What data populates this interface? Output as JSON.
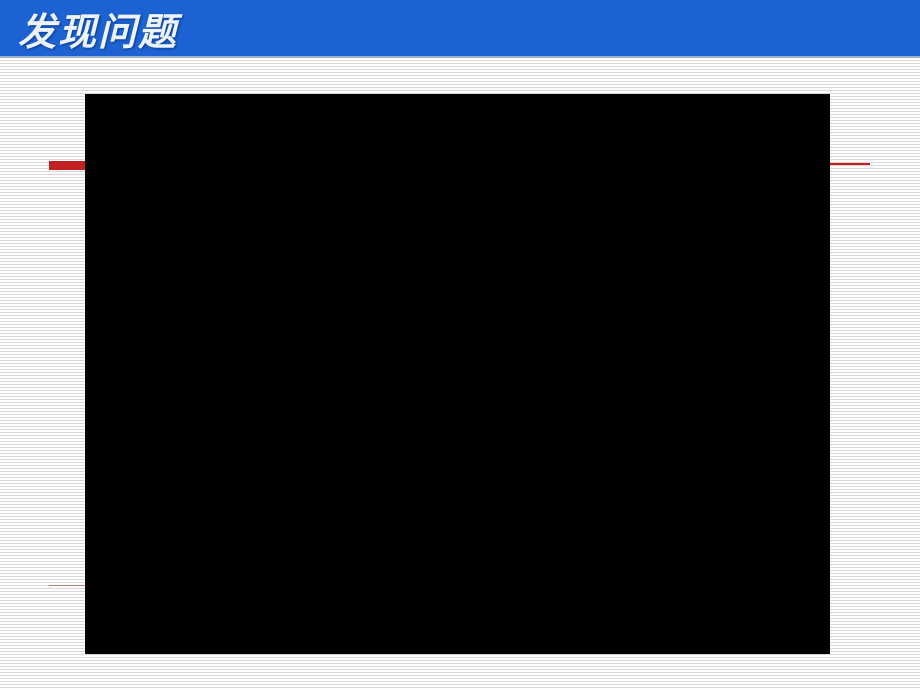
{
  "slide": {
    "title": "发现问题",
    "content_placeholder": "",
    "colors": {
      "title_bar_bg": "#1c62d2",
      "title_text": "#eef4ff",
      "accent_red": "#c22020",
      "stripe_light": "#fdfdfd",
      "stripe_dark": "#d8d8d8",
      "black_box": "#000000"
    }
  }
}
